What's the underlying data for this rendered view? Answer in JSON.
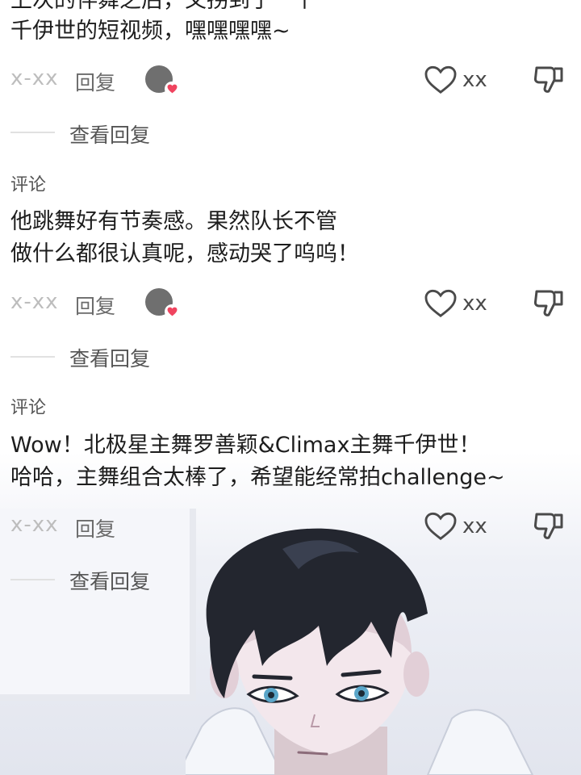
{
  "comments": [
    {
      "label": "",
      "lines": [
        "上次的伴舞之后，又拐到了一个",
        "千伊世的短视频，嘿嘿嘿嘿~"
      ],
      "user": "x-xx",
      "reply": "回复",
      "likes": "xx",
      "view_replies": "查看回复"
    },
    {
      "label": "评论",
      "lines": [
        "他跳舞好有节奏感。果然队长不管",
        "做什么都很认真呢，感动哭了呜呜！"
      ],
      "user": "x-xx",
      "reply": "回复",
      "likes": "xx",
      "view_replies": "查看回复"
    },
    {
      "label": "评论",
      "lines": [
        "Wow！北极星主舞罗善颖&Climax主舞千伊世！",
        "哈哈，主舞组合太棒了，希望能经常拍challenge~"
      ],
      "user": "x-xx",
      "reply": "回复",
      "likes": "xx",
      "view_replies": "查看回复"
    }
  ],
  "icons": {
    "avatar": "avatar-with-heart",
    "like": "heart-outline-icon",
    "dislike": "thumbs-down-icon"
  },
  "colors": {
    "accent_heart": "#f0445f",
    "avatar": "#6f6f6f",
    "hair": "#23262f",
    "eyes": "#5aa6c9"
  }
}
